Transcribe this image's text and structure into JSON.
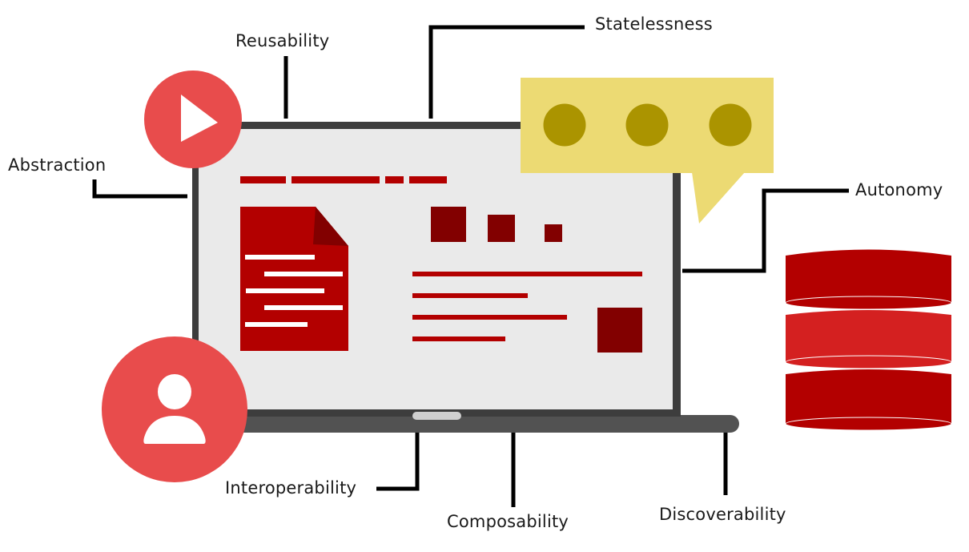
{
  "diagram": {
    "type": "service-principles-illustration",
    "labels": {
      "reusability": "Reusability",
      "statelessness": "Statelessness",
      "abstraction": "Abstraction",
      "autonomy": "Autonomy",
      "interoperability": "Interoperability",
      "composability": "Composability",
      "discoverability": "Discoverability"
    },
    "icons": {
      "play": "play-icon",
      "user": "user-icon",
      "chat": "chat-bubble-icon",
      "database": "database-icon",
      "document": "document-icon",
      "laptop": "laptop-icon"
    },
    "colors": {
      "coral": "#e84c4c",
      "dark_red": "#b30000",
      "maroon": "#820000",
      "bright_red": "#d42020",
      "yellow": "#ecda73",
      "olive": "#ab9400",
      "frame": "#3d3d3d",
      "base": "#525252",
      "screen": "#eaeaea",
      "trackpad": "#d0d0d0",
      "connector": "#000000",
      "text": "#1a1a1a"
    }
  }
}
